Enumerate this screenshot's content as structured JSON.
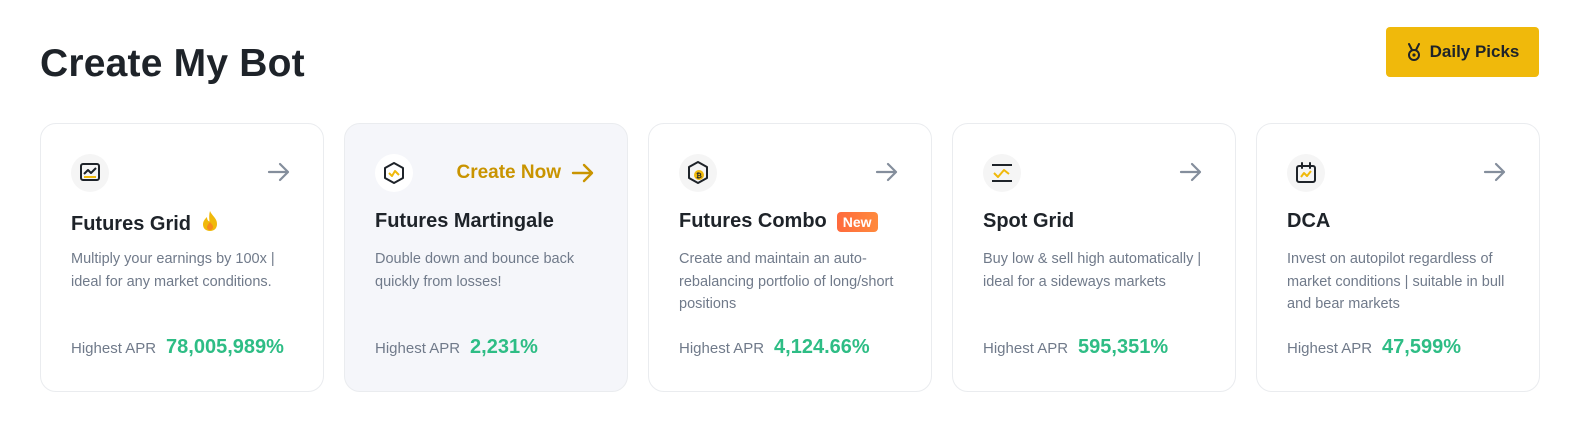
{
  "header": {
    "title": "Create My Bot",
    "daily_picks_label": "Daily Picks",
    "daily_picks_icon": "medal-icon"
  },
  "colors": {
    "accent": "#F0B90B",
    "cta": "#C99400",
    "positive": "#2EBD85",
    "badge_new": "#FF6A3D"
  },
  "cards": [
    {
      "title": "Futures Grid",
      "icon": "futures-grid-icon",
      "title_emoji": "🔥",
      "description": "Multiply your earnings by 100x | ideal for any market conditions.",
      "apr_label": "Highest APR",
      "apr_value": "78,005,989%"
    },
    {
      "title": "Futures Martingale",
      "icon": "futures-martingale-icon",
      "cta": "Create Now",
      "description": "Double down and bounce back quickly from losses!",
      "apr_label": "Highest APR",
      "apr_value": "2,231%"
    },
    {
      "title": "Futures Combo",
      "icon": "futures-combo-icon",
      "badge": "New",
      "description": "Create and maintain an auto-rebalancing portfolio of long/short positions",
      "apr_label": "Highest APR",
      "apr_value": "4,124.66%"
    },
    {
      "title": "Spot Grid",
      "icon": "spot-grid-icon",
      "description": "Buy low & sell high automatically | ideal for a sideways markets",
      "apr_label": "Highest APR",
      "apr_value": "595,351%"
    },
    {
      "title": "DCA",
      "icon": "dca-icon",
      "description": "Invest on autopilot regardless of market conditions | suitable in bull and bear markets",
      "apr_label": "Highest APR",
      "apr_value": "47,599%"
    }
  ]
}
